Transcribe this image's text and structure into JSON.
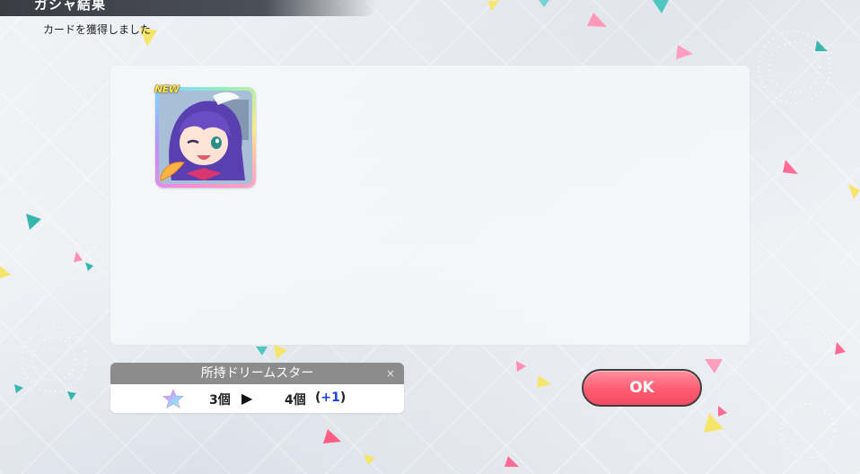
{
  "header": {
    "title": "ガシャ結果",
    "subtitle": "カードを獲得しました"
  },
  "result": {
    "cards": [
      {
        "badge": "NEW",
        "rarity_frame": "rainbow",
        "art_icon": "idol-portrait-icon"
      }
    ]
  },
  "dream_stars": {
    "title": "所持ドリームスター",
    "close_icon": "×",
    "before": "3個",
    "arrow": "▶",
    "after": "4個",
    "delta_open": "(",
    "delta_value": "+1",
    "delta_close": ")",
    "icon": "rainbow-star-icon"
  },
  "actions": {
    "ok_label": "OK"
  },
  "colors": {
    "ok_button": "#ff5d72",
    "delta_value": "#1d3fe0",
    "panel_header": "#8c8c8c"
  }
}
